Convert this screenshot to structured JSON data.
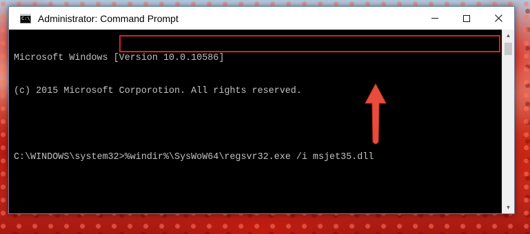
{
  "window": {
    "title": "Administrator: Command Prompt",
    "icon": "cmd-icon",
    "icon_glyph": "C:\\"
  },
  "console": {
    "lines": [
      "Microsoft Windows [Version 10.0.10586]",
      "(c) 2015 Microsoft Corporotion. All rights reserved.",
      "",
      "C:\\WINDOWS\\system32>%windir%\\SysWoW64\\regsvr32.exe /i msjet35.dll"
    ]
  },
  "colors": {
    "highlight": "#e02020",
    "arrow": "#e84c3d",
    "console_bg": "#000000",
    "console_text": "#c0c0c0"
  }
}
